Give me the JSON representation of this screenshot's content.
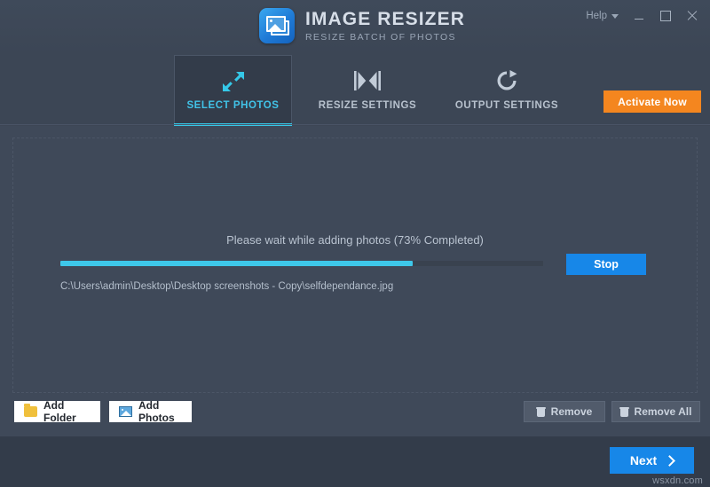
{
  "app": {
    "title": "IMAGE RESIZER",
    "subtitle": "RESIZE BATCH OF PHOTOS",
    "logo_icon": "image-stack-icon"
  },
  "titlebar": {
    "help_label": "Help",
    "help_caret_icon": "chevron-down-icon",
    "minimize_icon": "minimize-icon",
    "maximize_icon": "maximize-icon",
    "close_icon": "close-icon"
  },
  "tabs": [
    {
      "label": "SELECT PHOTOS",
      "icon": "expand-arrows-icon",
      "active": true
    },
    {
      "label": "RESIZE SETTINGS",
      "icon": "resize-width-icon",
      "active": false
    },
    {
      "label": "OUTPUT SETTINGS",
      "icon": "refresh-circle-icon",
      "active": false
    }
  ],
  "activate": {
    "label": "Activate Now"
  },
  "progress": {
    "status_text": "Please wait while adding photos (73% Completed)",
    "percent": 73,
    "current_file": "C:\\Users\\admin\\Desktop\\Desktop screenshots - Copy\\selfdependance.jpg",
    "stop_label": "Stop"
  },
  "actions": {
    "add_folder": "Add Folder",
    "add_folder_icon": "folder-icon",
    "add_photos": "Add Photos",
    "add_photos_icon": "photo-icon",
    "remove": "Remove",
    "remove_icon": "trash-icon",
    "remove_all": "Remove All",
    "remove_all_icon": "trash-icon"
  },
  "footer": {
    "next_label": "Next",
    "next_icon": "chevron-right-icon",
    "watermark": "wsxdn.com"
  },
  "colors": {
    "accent_cyan": "#35c8e8",
    "accent_blue": "#1787e8",
    "accent_orange": "#f4861f",
    "background": "#3f4959",
    "panel": "#333c4a"
  }
}
